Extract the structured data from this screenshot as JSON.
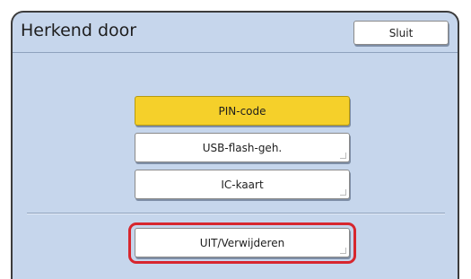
{
  "dialog": {
    "title": "Herkend door",
    "close_label": "Sluit"
  },
  "options": [
    {
      "label": "PIN-code",
      "selected": true
    },
    {
      "label": "USB-flash-geh.",
      "selected": false
    },
    {
      "label": "IC-kaart",
      "selected": false
    }
  ],
  "off_option": {
    "label": "UIT/Verwijderen",
    "highlighted": true
  },
  "colors": {
    "panel_background": "#c6d6ec",
    "selected_button": "#f5d02a",
    "highlight_ring": "#d7262e"
  }
}
